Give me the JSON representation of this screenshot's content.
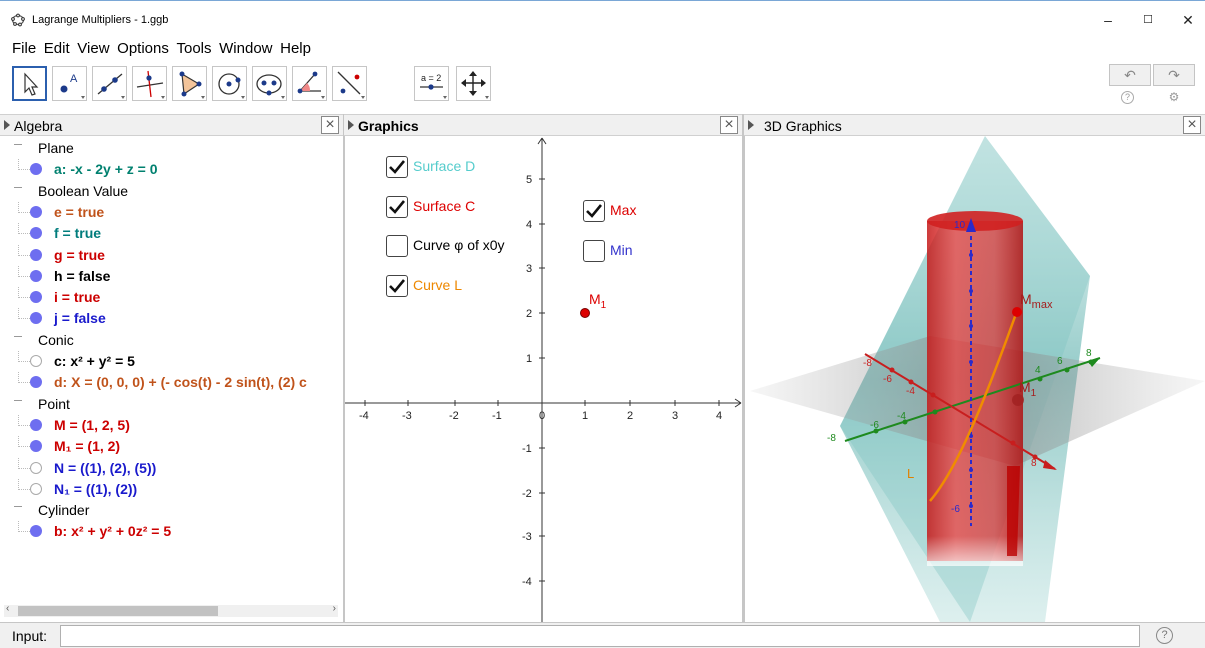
{
  "window": {
    "title": "Lagrange Multipliers - 1.ggb",
    "minimize": "–",
    "maximize": "☐",
    "close": "✕"
  },
  "menu": [
    "File",
    "Edit",
    "View",
    "Options",
    "Tools",
    "Window",
    "Help"
  ],
  "toolbar": {
    "tools": [
      "move-tool-icon",
      "point-tool-icon",
      "line-tool-icon",
      "perpendicular-line-tool-icon",
      "polygon-tool-icon",
      "circle-tool-icon",
      "conic-tool-icon",
      "angle-tool-icon",
      "reflect-tool-icon",
      "slider-tool-icon",
      "move-graphics-tool-icon"
    ],
    "slider_label": "a = 2",
    "undo": "↶",
    "redo": "↷",
    "help": "?",
    "settings": "⚙"
  },
  "panels": {
    "algebra": {
      "title": "Algebra"
    },
    "graphics": {
      "title": "Graphics"
    },
    "graphics3d": {
      "title": "3D Graphics"
    }
  },
  "algebra": {
    "rows": [
      {
        "kind": "cat",
        "text": "Plane"
      },
      {
        "kind": "item",
        "text": "a: -x - 2y + z = 0",
        "color": "#00806f",
        "visible": true
      },
      {
        "kind": "cat",
        "text": "Boolean Value"
      },
      {
        "kind": "item",
        "text": "e = true",
        "color": "#c0531b",
        "visible": true
      },
      {
        "kind": "item",
        "text": "f = true",
        "color": "#007c7c",
        "visible": true
      },
      {
        "kind": "item",
        "text": "g = true",
        "color": "#cc0000",
        "visible": true
      },
      {
        "kind": "item",
        "text": "h = false",
        "color": "#000000",
        "visible": true
      },
      {
        "kind": "item",
        "text": "i = true",
        "color": "#cc0000",
        "visible": true
      },
      {
        "kind": "item",
        "text": "j = false",
        "color": "#1a1acc",
        "visible": true
      },
      {
        "kind": "cat",
        "text": "Conic"
      },
      {
        "kind": "item",
        "text": "c: x² + y² = 5",
        "color": "#000000",
        "visible": false
      },
      {
        "kind": "item",
        "text": "d: X = (0, 0, 0) + (- cos(t) - 2 sin(t), (2) c",
        "color": "#c0531b",
        "visible": true
      },
      {
        "kind": "cat",
        "text": "Point"
      },
      {
        "kind": "item",
        "text": "M = (1, 2, 5)",
        "color": "#cc0000",
        "visible": true
      },
      {
        "kind": "item",
        "text": "M₁ = (1, 2)",
        "color": "#cc0000",
        "visible": true
      },
      {
        "kind": "item",
        "text": "N = ((1), (2), (5))",
        "color": "#1a1acc",
        "visible": false
      },
      {
        "kind": "item",
        "text": "N₁ = ((1), (2))",
        "color": "#1a1acc",
        "visible": false
      },
      {
        "kind": "cat",
        "text": "Cylinder"
      },
      {
        "kind": "item",
        "text": "b: x² + y² + 0z² = 5",
        "color": "#cc0000",
        "visible": true
      }
    ]
  },
  "graphics": {
    "checkboxes": [
      {
        "label": "Surface D",
        "checked": true,
        "color": "#55cccc"
      },
      {
        "label": "Surface C",
        "checked": true,
        "color": "#dd0000"
      },
      {
        "label": "Curve φ of x0y",
        "checked": false,
        "color": "#000000"
      },
      {
        "label": "Curve L",
        "checked": true,
        "color": "#ee8800"
      },
      {
        "label": "Max",
        "checked": true,
        "color": "#dd0000"
      },
      {
        "label": "Min",
        "checked": false,
        "color": "#3333cc"
      }
    ],
    "x_ticks": [
      "-4",
      "-3",
      "-2",
      "-1",
      "0",
      "1",
      "2",
      "3",
      "4"
    ],
    "y_ticks": [
      "5",
      "4",
      "3",
      "2",
      "1",
      "-1",
      "-2",
      "-3",
      "-4"
    ],
    "point_label": "M",
    "point_sub": "1"
  },
  "graphics3d": {
    "labels": {
      "mmax": "M",
      "mmax_sub": "max",
      "m1": "M",
      "m1_sub": "1",
      "l": "L"
    },
    "x_ticks": [
      "-8",
      "-6",
      "-4",
      "2",
      "4",
      "6",
      "8"
    ],
    "y_ticks": [
      "-8",
      "-6",
      "-4",
      "4",
      "6",
      "8"
    ],
    "z_ticks": [
      "10",
      "-2",
      "-4",
      "-6"
    ]
  },
  "input": {
    "label": "Input:",
    "placeholder": ""
  }
}
